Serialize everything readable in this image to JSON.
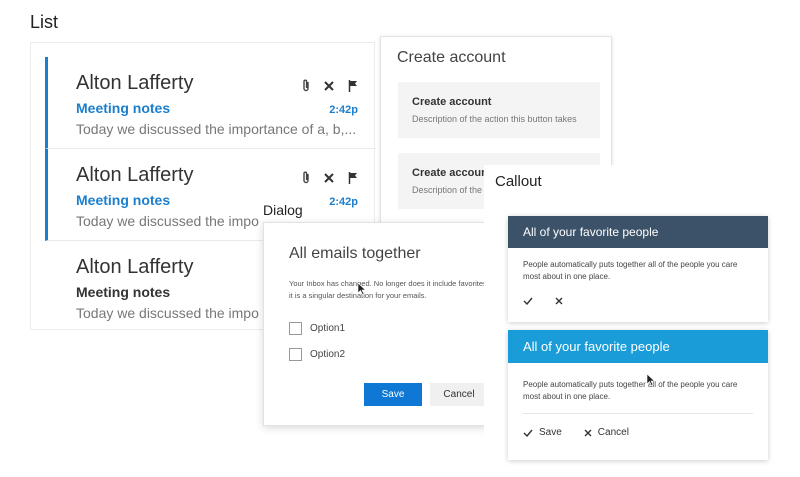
{
  "list": {
    "title": "List",
    "items": [
      {
        "name": "Alton Lafferty",
        "subject": "Meeting notes",
        "preview": "Today we discussed the importance of a, b,...",
        "time": "2:42p"
      },
      {
        "name": "Alton Lafferty",
        "subject": "Meeting notes",
        "preview": "Today we discussed the impo",
        "time": "2:42p"
      },
      {
        "name": "Alton Lafferty",
        "subject": "Meeting notes",
        "preview": "Today we discussed the impo"
      }
    ]
  },
  "create_account": {
    "title": "Create account",
    "buttons": [
      {
        "label": "Create account",
        "description": "Description of the action this button takes"
      },
      {
        "label": "Create account",
        "description": "Description of the action this button takes"
      }
    ]
  },
  "dialog": {
    "section_label": "Dialog",
    "title": "All emails together",
    "text": "Your Inbox has changed. No longer does it include favorites, it is a singular destination for your emails.",
    "options": [
      "Option1",
      "Option2"
    ],
    "save_label": "Save",
    "cancel_label": "Cancel"
  },
  "callout": {
    "section_label": "Callout",
    "cards": [
      {
        "title": "All of your favorite people",
        "text": "People automatically puts together all of the people you care most about in one place."
      },
      {
        "title": "All of your favorite people",
        "text": "People automatically puts together all of the people you care most about in one place.",
        "save_label": "Save",
        "cancel_label": "Cancel"
      }
    ]
  },
  "colors": {
    "accent": "#1b7fcf",
    "primary_button": "#0e78d4",
    "callout_dark": "#3c5268",
    "callout_blue": "#1a9cd8"
  }
}
